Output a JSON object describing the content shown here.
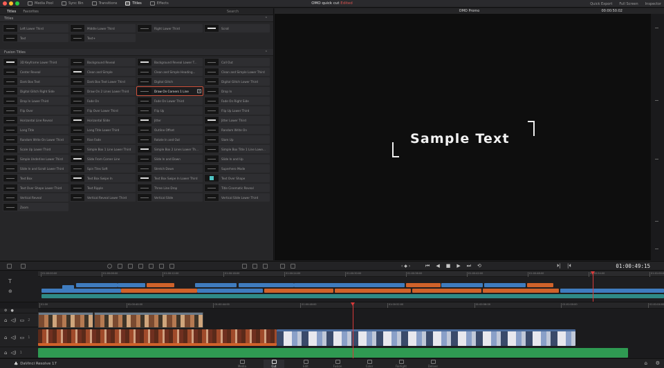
{
  "window": {
    "traffic_lights": [
      "#ff5f57",
      "#febc2e",
      "#28c840"
    ]
  },
  "toolbar": {
    "tabs": [
      {
        "label": "Media Pool"
      },
      {
        "label": "Sync Bin"
      },
      {
        "label": "Transitions"
      },
      {
        "label": "Titles"
      },
      {
        "label": "Effects"
      }
    ],
    "project_title": "OMO quick cut",
    "edited_label": "Edited",
    "right_items": [
      "Quick Export",
      "Full Screen",
      "Inspector"
    ]
  },
  "panel": {
    "tabs": [
      "Titles",
      "Favorites"
    ],
    "search_label": "Search",
    "titles_section": "Titles",
    "titles": [
      {
        "label": "Left Lower Third",
        "thumb": "dim"
      },
      {
        "label": "Middle Lower Third",
        "thumb": "dim"
      },
      {
        "label": "Right Lower Third",
        "thumb": "dim"
      },
      {
        "label": "Scroll",
        "thumb": "white"
      },
      {
        "label": "Text",
        "thumb": "dim"
      },
      {
        "label": "Text+",
        "thumb": "dim"
      }
    ],
    "fusion_section": "Fusion Titles",
    "fusion_titles": [
      {
        "label": "3D Keyframe Lower Third",
        "thumb": "white"
      },
      {
        "label": "Background Reveal",
        "thumb": "dim"
      },
      {
        "label": "Background Reveal Lower T...",
        "thumb": "white"
      },
      {
        "label": "Call Out",
        "thumb": "dim"
      },
      {
        "label": "Center Reveal",
        "thumb": "dim"
      },
      {
        "label": "Clean and Simple",
        "thumb": "white"
      },
      {
        "label": "Clean and Simple Heading...",
        "thumb": "dim"
      },
      {
        "label": "Clean and Simple Lower Third",
        "thumb": "dim"
      },
      {
        "label": "Dark Box Text",
        "thumb": "dim"
      },
      {
        "label": "Dark Box Text Lower Third",
        "thumb": "dim"
      },
      {
        "label": "Digital Glitch",
        "thumb": "dim"
      },
      {
        "label": "Digital Glitch Lower Third",
        "thumb": "dim"
      },
      {
        "label": "Digital Glitch Right Side",
        "thumb": "dim"
      },
      {
        "label": "Draw On 2 Lines Lower Third",
        "thumb": "dim"
      },
      {
        "label": "Draw On Corners 1 Line",
        "thumb": "dim",
        "selected": true
      },
      {
        "label": "Drop In",
        "thumb": "dim"
      },
      {
        "label": "Drop In Lower Third",
        "thumb": "dim"
      },
      {
        "label": "Fade On",
        "thumb": "dim"
      },
      {
        "label": "Fade On Lower Third",
        "thumb": "dim"
      },
      {
        "label": "Fade On Right Side",
        "thumb": "dim"
      },
      {
        "label": "Flip Over",
        "thumb": "dim"
      },
      {
        "label": "Flip Over Lower Third",
        "thumb": "dim"
      },
      {
        "label": "Flip Up",
        "thumb": "dim"
      },
      {
        "label": "Flip Up Lower Third",
        "thumb": "dim"
      },
      {
        "label": "Horizontal Line Reveal",
        "thumb": "dim"
      },
      {
        "label": "Horizontal Slide",
        "thumb": "white"
      },
      {
        "label": "Jitter",
        "thumb": "white"
      },
      {
        "label": "Jitter Lower Third",
        "thumb": "white"
      },
      {
        "label": "Long Title",
        "thumb": "dim"
      },
      {
        "label": "Long Title Lower Third",
        "thumb": "dim"
      },
      {
        "label": "Outline Offset",
        "thumb": "dim"
      },
      {
        "label": "Random Write On",
        "thumb": "dim"
      },
      {
        "label": "Random Write On Lower Third",
        "thumb": "dim"
      },
      {
        "label": "Rise Fade",
        "thumb": "dim"
      },
      {
        "label": "Rotate In and Out",
        "thumb": "dim"
      },
      {
        "label": "Slam Up",
        "thumb": "dim"
      },
      {
        "label": "Scale Up Lower Third",
        "thumb": "dim"
      },
      {
        "label": "Simple Box 1 Line Lower Third",
        "thumb": "dim"
      },
      {
        "label": "Simple Box 2 Lines Lower Th...",
        "thumb": "white"
      },
      {
        "label": "Simple Box Title 1 Line Lowe...",
        "thumb": "dim"
      },
      {
        "label": "Simple Underline Lower Third",
        "thumb": "dim"
      },
      {
        "label": "Slide From Corner Line",
        "thumb": "white"
      },
      {
        "label": "Slide In and Down",
        "thumb": "dim"
      },
      {
        "label": "Slide In and Up",
        "thumb": "dim"
      },
      {
        "label": "Slide In and Scroll Lower Third",
        "thumb": "dim"
      },
      {
        "label": "Spin Tiles Soft",
        "thumb": "dim"
      },
      {
        "label": "Stretch Down",
        "thumb": "dim"
      },
      {
        "label": "Superhero Mode",
        "thumb": "dim"
      },
      {
        "label": "Text Box",
        "thumb": "dim"
      },
      {
        "label": "Text Box Swipe In",
        "thumb": "white"
      },
      {
        "label": "Text Box Swipe In Lower Third",
        "thumb": "white"
      },
      {
        "label": "Text Over Shape",
        "thumb": "teal"
      },
      {
        "label": "Text Over Shape Lower Third",
        "thumb": "dim"
      },
      {
        "label": "Text Ripple",
        "thumb": "dim"
      },
      {
        "label": "Three Line Drop",
        "thumb": "dim"
      },
      {
        "label": "Title Cinematic Reveal",
        "thumb": "dim"
      },
      {
        "label": "Vertical Reveal",
        "thumb": "dim"
      },
      {
        "label": "Vertical Reveal Lower Third",
        "thumb": "dim"
      },
      {
        "label": "Vertical Slide",
        "thumb": "dim"
      },
      {
        "label": "Vertical Slide Lower Third",
        "thumb": "dim"
      },
      {
        "label": "Zoom",
        "thumb": "dim"
      }
    ]
  },
  "viewer": {
    "title": "OMO Promo",
    "top_timecode": "00:00:50:02",
    "sample_text": "Sample Text"
  },
  "transport": {
    "timecode": "01:00:49:15",
    "controls": [
      "⏮",
      "◀",
      "■",
      "▶",
      "⏭",
      "⟲"
    ]
  },
  "timeline": {
    "upper_ticks": [
      "01:00:00:00",
      "01:00:06:00",
      "01:00:12:00",
      "01:00:18:00",
      "01:00:24:00",
      "01:00:30:00",
      "01:00:36:00",
      "01:00:42:00",
      "01:00:48:00",
      "01:00:54:00",
      "01:01:00:00"
    ],
    "lower_ticks": [
      "01:00",
      "01:00:40:00",
      "01:00:44:00",
      "01:00:48:00",
      "01:00:52:00",
      "01:00:56:00",
      "01:01:00:00",
      "01:01:04:00"
    ],
    "track_labels": [
      "2",
      "1",
      "1"
    ],
    "colors": {
      "blue": "#3f7cbf",
      "orange": "#d0622a",
      "teal": "#2f8a86",
      "green": "#2f9a52",
      "playhead": "#d93b3b"
    }
  },
  "pagebar": {
    "app_name": "DaVinci Resolve 17",
    "pages": [
      "Media",
      "Cut",
      "Edit",
      "Fusion",
      "Color",
      "Fairlight",
      "Deliver"
    ],
    "active_page": "Cut"
  }
}
